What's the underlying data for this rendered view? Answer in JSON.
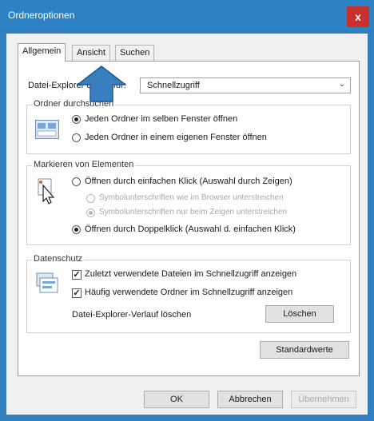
{
  "window": {
    "title": "Ordneroptionen",
    "close_label": "x"
  },
  "tabs": [
    {
      "label": "Allgemein",
      "active": true
    },
    {
      "label": "Ansicht",
      "active": false
    },
    {
      "label": "Suchen",
      "active": false
    }
  ],
  "general": {
    "explorer_open_label": "Datei-Explorer öffnen für:",
    "explorer_open_value": "Schnellzugriff",
    "folder_browse": {
      "title": "Ordner durchsuchen",
      "options": [
        {
          "label": "Jeden Ordner im selben Fenster öffnen",
          "checked": true
        },
        {
          "label": "Jeden Ordner in einem eigenen Fenster öffnen",
          "checked": false
        }
      ]
    },
    "click_items": {
      "title": "Markieren von Elementen",
      "options": [
        {
          "label": "Öffnen durch einfachen Klick (Auswahl durch Zeigen)",
          "checked": false,
          "disabled": false
        },
        {
          "label": "Symbolunterschriften wie im Browser unterstreichen",
          "checked": false,
          "disabled": true
        },
        {
          "label": "Symbolunterschriften nur beim Zeigen unterstreichen",
          "checked": true,
          "disabled": true
        },
        {
          "label": "Öffnen durch Doppelklick (Auswahl d. einfachen Klick)",
          "checked": true,
          "disabled": false
        }
      ]
    },
    "privacy": {
      "title": "Datenschutz",
      "options": [
        {
          "label": "Zuletzt verwendete Dateien im Schnellzugriff anzeigen",
          "checked": true
        },
        {
          "label": "Häufig verwendete Ordner im Schnellzugriff anzeigen",
          "checked": true
        }
      ],
      "clear_history_label": "Datei-Explorer-Verlauf löschen",
      "clear_button": "Löschen"
    },
    "defaults_button": "Standardwerte"
  },
  "footer": {
    "ok": "OK",
    "cancel": "Abbrechen",
    "apply": "Übernehmen"
  },
  "colors": {
    "titlebar": "#2d82c4",
    "close": "#c7302b",
    "arrow": "#3a7ec2"
  }
}
